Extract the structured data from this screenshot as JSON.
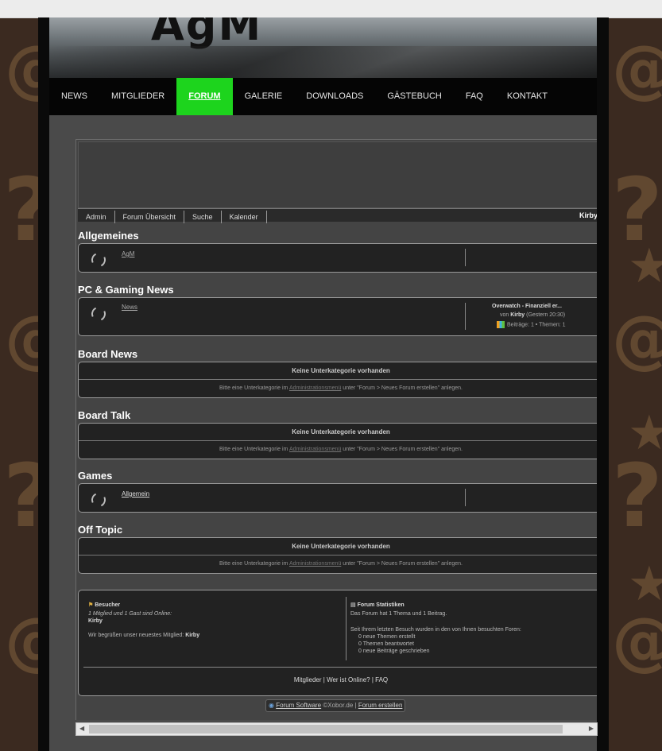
{
  "banner": {
    "title": "AgM"
  },
  "nav": {
    "items": [
      {
        "label": "NEWS"
      },
      {
        "label": "MITGLIEDER"
      },
      {
        "label": "FORUM"
      },
      {
        "label": "GALERIE"
      },
      {
        "label": "DOWNLOADS"
      },
      {
        "label": "GÄSTEBUCH"
      },
      {
        "label": "FAQ"
      },
      {
        "label": "KONTAKT"
      }
    ],
    "active": "FORUM"
  },
  "forum": {
    "tabs": [
      "Admin",
      "Forum Übersicht",
      "Suche",
      "Kalender"
    ],
    "user": "Kirby",
    "categories": {
      "allgemeines": {
        "title": "Allgemeines",
        "sub": "AgM"
      },
      "pc_news": {
        "title": "PC & Gaming News",
        "sub": "News",
        "last_title": "Overwatch - Finanziell er...",
        "last_by_prefix": "von",
        "last_by_user": "Kirby",
        "last_by_time": "(Gestern 20:30)",
        "last_stats": "Beiträge: 1 • Themen: 1"
      },
      "board_news": {
        "title": "Board News"
      },
      "board_talk": {
        "title": "Board Talk"
      },
      "games": {
        "title": "Games",
        "sub": "Allgemein"
      },
      "off_topic": {
        "title": "Off Topic"
      }
    },
    "no_subcategory": "Keine Unterkategorie vorhanden",
    "hint_pre": "Bitte eine Unterkategorie im",
    "hint_link": "Administrationsmenü",
    "hint_post": "unter \"Forum > Neues Forum erstellen\" anlegen.",
    "visitors": {
      "title": "Besucher",
      "online": "1 Mitglied und 1 Gast sind Online:",
      "online_user": "Kirby",
      "welcome": "Wir begrüßen unser neuestes Mitglied:",
      "newest": "Kirby"
    },
    "stats": {
      "title": "Forum Statistiken",
      "summary": "Das Forum hat 1 Thema und 1 Beitrag.",
      "since": "Seit Ihrem letzten Besuch wurden in den von Ihnen besuchten Foren:",
      "new_topics": "0 neue Themen erstellt",
      "answered": "0 Themen beantwortet",
      "new_posts": "0 neue Beiträge geschrieben"
    },
    "footer_links": {
      "members": "Mitglieder",
      "who": "Wer ist Online?",
      "faq": "FAQ"
    },
    "credit": {
      "software": "Forum Software",
      "copyright": "©Xobor.de",
      "create": "Forum erstellen"
    }
  }
}
